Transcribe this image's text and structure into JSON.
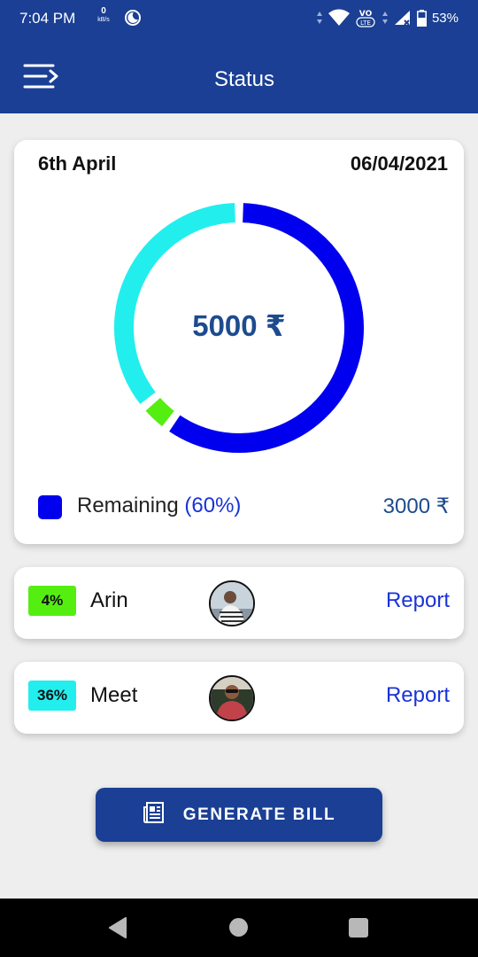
{
  "status_bar": {
    "time": "7:04 PM",
    "net_speed": "0",
    "net_unit": "kB/s",
    "network_label": "VoLTE",
    "battery": "53%"
  },
  "app_bar": {
    "title": "Status",
    "menu_icon": "menu-icon"
  },
  "summary": {
    "day_label": "6th April",
    "date": "06/04/2021",
    "total": "5000 ₹",
    "legend": {
      "label": "Remaining",
      "percent": "(60%)",
      "amount": "3000 ₹"
    }
  },
  "chart_data": {
    "type": "pie",
    "variant": "donut",
    "title": "",
    "center_label": "5000 ₹",
    "slices": [
      {
        "name": "Remaining",
        "value": 60,
        "color": "#0000ee"
      },
      {
        "name": "Arin",
        "value": 4,
        "color": "#55ee11"
      },
      {
        "name": "Meet",
        "value": 36,
        "color": "#22eeee"
      }
    ]
  },
  "members": [
    {
      "percent": "4%",
      "name": "Arin",
      "badge_color": "#55ee11",
      "action": "Report"
    },
    {
      "percent": "36%",
      "name": "Meet",
      "badge_color": "#22eeee",
      "action": "Report"
    }
  ],
  "generate_button": {
    "label": "GENERATE BILL",
    "icon": "receipt-icon"
  },
  "nav_bar": {
    "back_icon": "back-icon",
    "home_icon": "home-icon",
    "recents_icon": "recents-icon"
  },
  "colors": {
    "primary": "#1a3f94",
    "remaining": "#0000ee",
    "accent_text": "#1d4b8e",
    "link": "#1a33d6"
  }
}
